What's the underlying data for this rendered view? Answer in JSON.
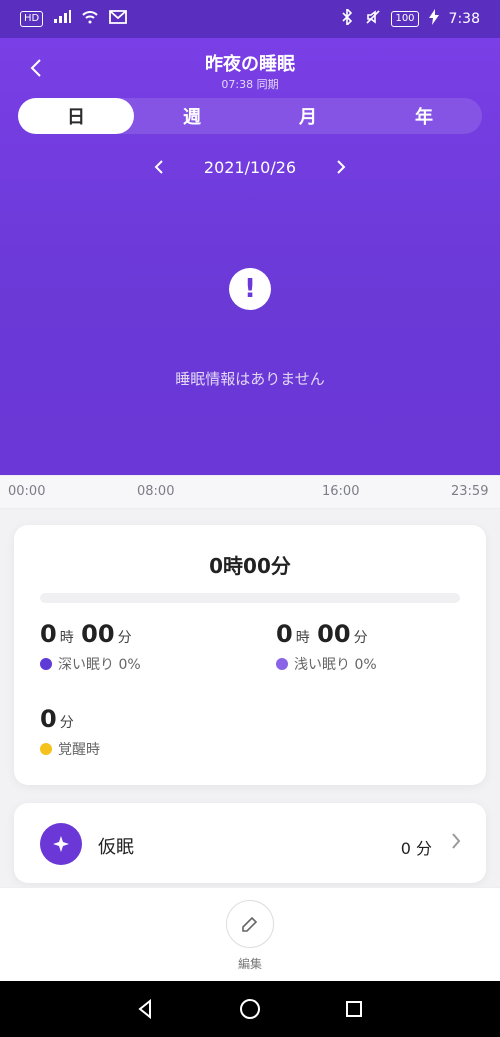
{
  "status_bar": {
    "time": "7:38",
    "left_badge": "HD",
    "battery": "100"
  },
  "header": {
    "title": "昨夜の睡眠",
    "sync": "07:38 同期",
    "tabs": [
      {
        "label": "日",
        "active": true
      },
      {
        "label": "週",
        "active": false
      },
      {
        "label": "月",
        "active": false
      },
      {
        "label": "年",
        "active": false
      }
    ],
    "date": "2021/10/26",
    "no_data": "睡眠情報はありません"
  },
  "timeline": {
    "labels": [
      "00:00",
      "08:00",
      "16:00",
      "23:59"
    ]
  },
  "summary": {
    "total": "0時00分",
    "deep": {
      "hours": "0",
      "hours_unit": "時",
      "minutes": "00",
      "minutes_unit": "分",
      "label": "深い眠り 0%"
    },
    "light": {
      "hours": "0",
      "hours_unit": "時",
      "minutes": "00",
      "minutes_unit": "分",
      "label": "浅い眠り 0%"
    },
    "awake": {
      "minutes": "0",
      "minutes_unit": "分",
      "label": "覚醒時"
    },
    "colors": {
      "deep": "#5e3ad6",
      "light": "#8a63e6",
      "awake": "#f4c21a"
    }
  },
  "nap": {
    "label": "仮眠",
    "value": "0 分"
  },
  "bottom": {
    "edit_label": "編集"
  }
}
